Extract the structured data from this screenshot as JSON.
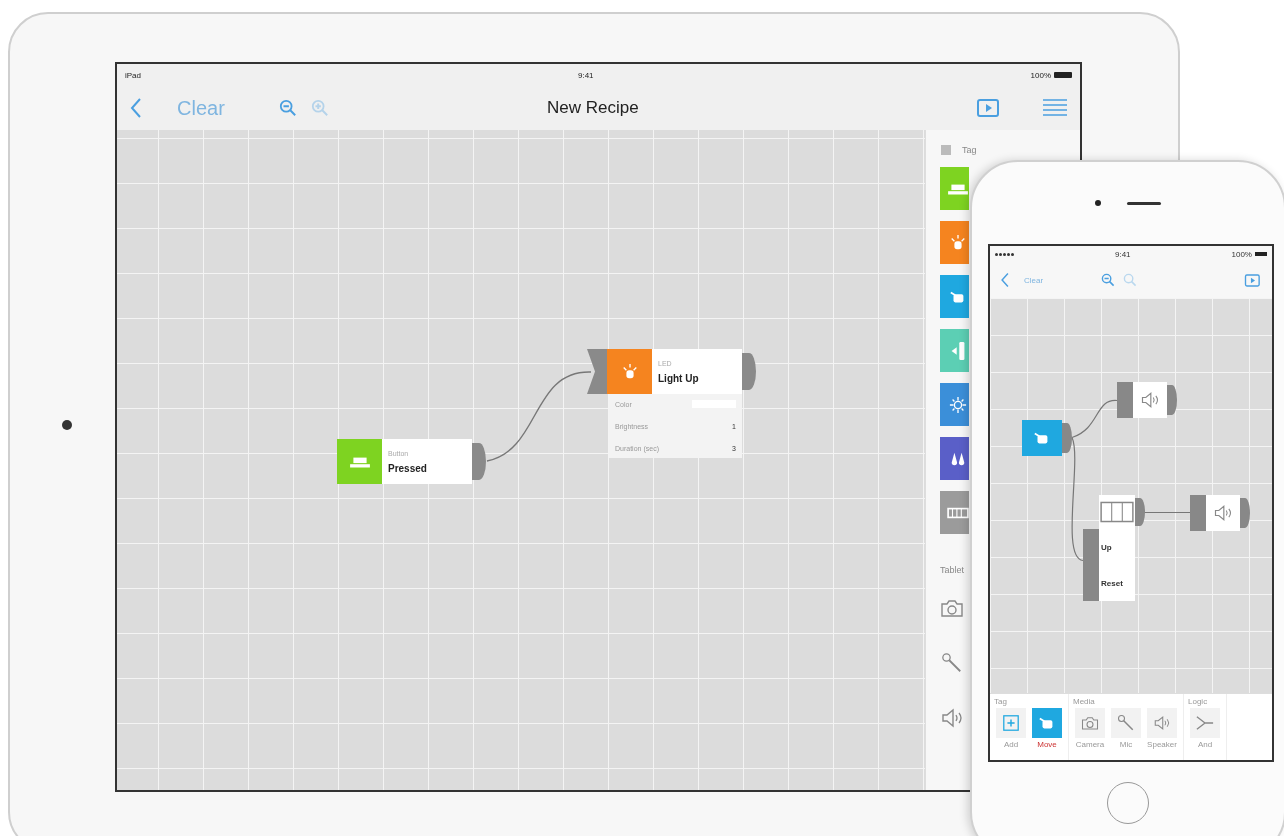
{
  "tablet": {
    "status": {
      "carrier": "iPad",
      "time": "9:41",
      "battery": "100%"
    },
    "nav": {
      "clear": "Clear",
      "title": "New Recipe"
    },
    "nodes": [
      {
        "kind": "button",
        "category": "Button",
        "action": "Pressed",
        "color": "#7ed321"
      },
      {
        "kind": "led",
        "category": "LED",
        "action": "Light Up",
        "color": "#f5841f",
        "params": [
          {
            "kind": "swatch",
            "label": "Color"
          },
          {
            "kind": "value",
            "label": "Brightness",
            "value": "1"
          },
          {
            "kind": "value",
            "label": "Duration (sec)",
            "value": "3"
          }
        ]
      }
    ],
    "palette": {
      "section": "Tag",
      "tiles": [
        {
          "kind": "button",
          "color": "#7ed321"
        },
        {
          "kind": "led",
          "color": "#f5841f"
        },
        {
          "kind": "move",
          "color": "#1fa8e0"
        },
        {
          "kind": "tilt",
          "color": "#5ccfb4"
        },
        {
          "kind": "light",
          "color": "#3b8fd9"
        },
        {
          "kind": "temp",
          "color": "#5a5fc8"
        },
        {
          "kind": "counter",
          "color": "#9b9b9b"
        }
      ],
      "section2": "Tablet",
      "tools": [
        {
          "kind": "camera"
        },
        {
          "kind": "mic"
        },
        {
          "kind": "speaker"
        }
      ]
    }
  },
  "phone": {
    "status": {
      "time": "9:41",
      "battery": "100%"
    },
    "nav": {
      "clear": "Clear"
    },
    "counter": {
      "up": "Up",
      "reset": "Reset"
    },
    "toolbar": [
      {
        "section": "Tag",
        "items": [
          {
            "kind": "add",
            "label": "Add",
            "selected": false
          },
          {
            "kind": "move",
            "label": "Move",
            "selected": true
          }
        ]
      },
      {
        "section": "Media",
        "items": [
          {
            "kind": "camera",
            "label": "Camera",
            "selected": false
          },
          {
            "kind": "mic",
            "label": "Mic",
            "selected": false
          },
          {
            "kind": "speaker",
            "label": "Speaker",
            "selected": false
          }
        ]
      },
      {
        "section": "Logic",
        "items": [
          {
            "kind": "and",
            "label": "And",
            "selected": false
          }
        ]
      }
    ]
  }
}
